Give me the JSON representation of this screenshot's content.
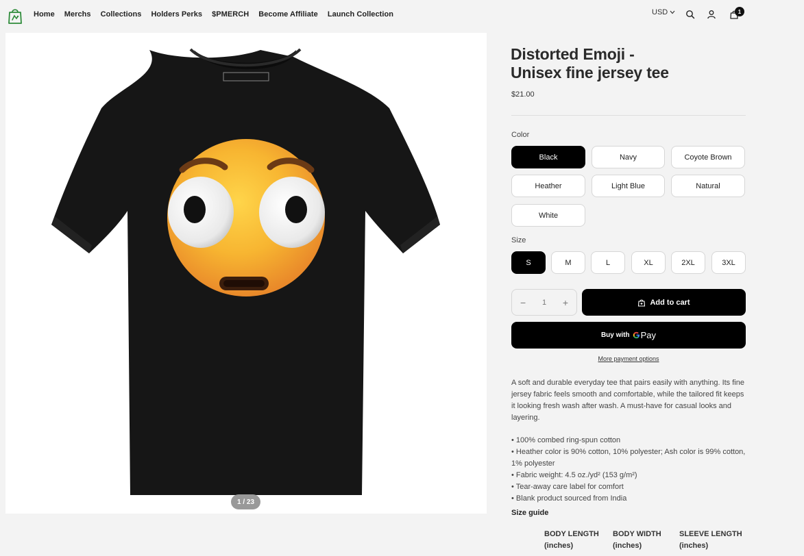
{
  "nav": {
    "items": [
      "Home",
      "Merchs",
      "Collections",
      "Holders Perks",
      "$PMERCH",
      "Become Affiliate",
      "Launch Collection"
    ]
  },
  "header": {
    "currency": "USD",
    "cart_count": "1"
  },
  "gallery": {
    "counter": "1 / 23"
  },
  "product": {
    "title_line1": "Distorted Emoji -",
    "title_line2": "Unisex fine jersey tee",
    "price": "$21.00",
    "color_label": "Color",
    "colors": [
      "Black",
      "Navy",
      "Coyote Brown",
      "Heather",
      "Light Blue",
      "Natural",
      "White"
    ],
    "selected_color": "Black",
    "size_label": "Size",
    "sizes": [
      "S",
      "M",
      "L",
      "XL",
      "2XL",
      "3XL"
    ],
    "selected_size": "S",
    "quantity": "1",
    "add_to_cart": "Add to cart",
    "buy_with": "Buy with",
    "gpay": "Pay",
    "more_payment": "More payment options",
    "description": "A soft and durable everyday tee that pairs easily with anything. Its fine jersey fabric feels smooth and comfortable, while the tailored fit keeps it looking fresh wash after wash. A must-have for casual looks and layering.",
    "bullets": [
      "• 100% combed ring-spun cotton",
      "• Heather color is 90% cotton, 10% polyester; Ash color is 99% cotton, 1% polyester",
      "• Fabric weight: 4.5 oz./yd² (153 g/m²)",
      "• Tear-away care label for comfort",
      "• Blank product sourced from India"
    ],
    "size_guide": "Size guide",
    "size_guide_columns": [
      {
        "title": "BODY LENGTH",
        "unit": "(inches)"
      },
      {
        "title": "BODY WIDTH",
        "unit": "(inches)"
      },
      {
        "title": "SLEEVE LENGTH",
        "unit": "(inches)"
      }
    ]
  },
  "colors": {
    "accent": "#000000",
    "logo_green": "#2e8b3a",
    "badge": "#111111"
  }
}
